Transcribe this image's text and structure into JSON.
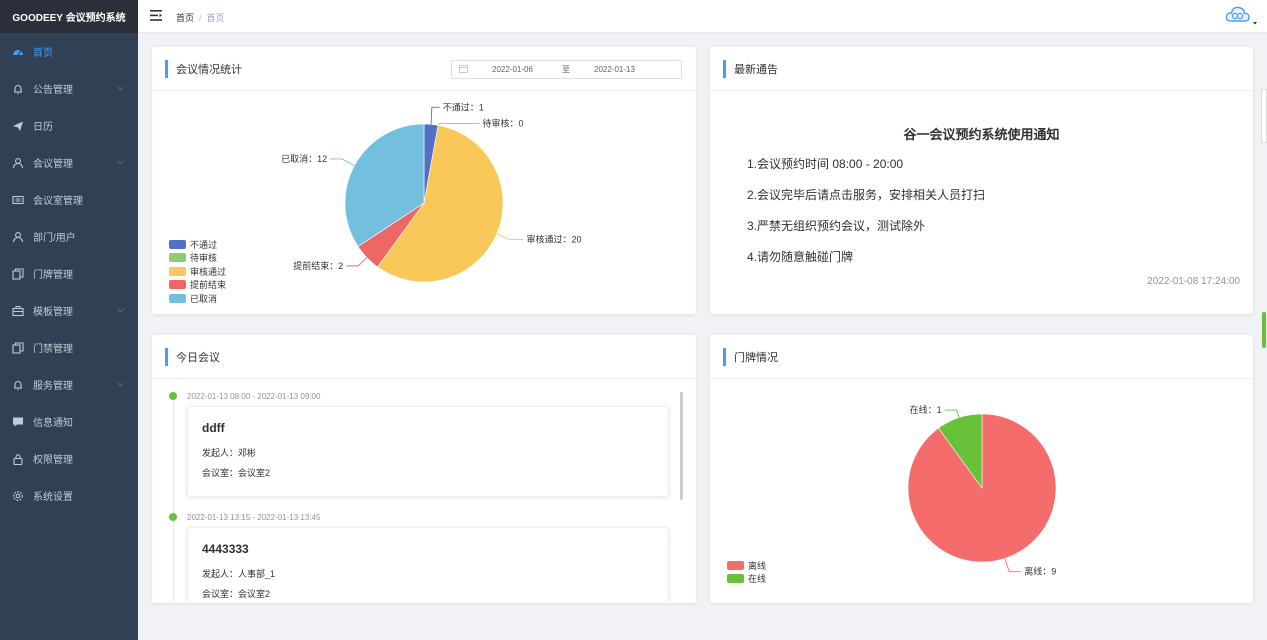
{
  "app": {
    "title": "GOODEEY 会议预约系统"
  },
  "sidebar": {
    "items": [
      {
        "label": "首页",
        "icon": "dashboard-icon",
        "active": true,
        "arrow": false
      },
      {
        "label": "公告管理",
        "icon": "bell-icon",
        "arrow": true
      },
      {
        "label": "日历",
        "icon": "send-icon",
        "arrow": false
      },
      {
        "label": "会议管理",
        "icon": "user-icon",
        "arrow": true
      },
      {
        "label": "会议室管理",
        "icon": "room-icon",
        "arrow": false
      },
      {
        "label": "部门/用户",
        "icon": "user-icon",
        "arrow": false
      },
      {
        "label": "门牌管理",
        "icon": "copy-icon",
        "arrow": false
      },
      {
        "label": "模板管理",
        "icon": "briefcase-icon",
        "arrow": true
      },
      {
        "label": "门禁管理",
        "icon": "copy-icon",
        "arrow": false
      },
      {
        "label": "服务管理",
        "icon": "bell-icon",
        "arrow": true
      },
      {
        "label": "信息通知",
        "icon": "message-icon",
        "arrow": false
      },
      {
        "label": "权限管理",
        "icon": "lock-icon",
        "arrow": false
      },
      {
        "label": "系统设置",
        "icon": "gear-icon",
        "arrow": false
      }
    ]
  },
  "header": {
    "breadcrumb": [
      "首页",
      "首页"
    ],
    "separator": "/"
  },
  "colors": {
    "accent": "#409eff",
    "sidebar_bg": "#304156",
    "dot_green": "#67c23a"
  },
  "stats_card": {
    "title": "会议情况统计",
    "date_start": "2022-01-06",
    "date_sep": "至",
    "date_end": "2022-01-13",
    "chart_data": {
      "type": "pie",
      "legend_position": "bottom-left",
      "slices": [
        {
          "name": "不通过",
          "value": 1,
          "label": "不通过：1",
          "color": "#5470c6"
        },
        {
          "name": "待审核",
          "value": 0,
          "label": "待审核：0",
          "color": "#91cc75"
        },
        {
          "name": "审核通过",
          "value": 20,
          "label": "审核通过：20",
          "color": "#fac858"
        },
        {
          "name": "提前结束",
          "value": 2,
          "label": "提前结束：2",
          "color": "#ee6666"
        },
        {
          "name": "已取消",
          "value": 12,
          "label": "已取消：12",
          "color": "#73c0de"
        }
      ]
    }
  },
  "notice_card": {
    "title": "最新通告",
    "notice_title": "谷一会议预约系统使用通知",
    "lines": [
      "1.会议预约时间 08:00 - 20:00",
      "2.会议完毕后请点击服务，安排相关人员打扫",
      "3.严禁无组织预约会议，测试除外",
      "4.请勿随意触碰门牌"
    ],
    "time": "2022-01-08 17:24:00"
  },
  "today_card": {
    "title": "今日会议",
    "meetings": [
      {
        "time": "2022-01-13 08:00 - 2022-01-13 09:00",
        "name": "ddff",
        "initiator": "发起人：邓彬",
        "room": "会议室：会议室2"
      },
      {
        "time": "2022-01-13 13:15 - 2022-01-13 13:45",
        "name": "4443333",
        "initiator": "发起人：人事部_1",
        "room": "会议室：会议室2"
      }
    ]
  },
  "door_card": {
    "title": "门牌情况",
    "chart_data": {
      "type": "pie",
      "legend_position": "bottom-left",
      "slices": [
        {
          "name": "离线",
          "value": 9,
          "label": "离线：9",
          "color": "#f56c6c"
        },
        {
          "name": "在线",
          "value": 1,
          "label": "在线：1",
          "color": "#67c23a"
        }
      ]
    }
  }
}
